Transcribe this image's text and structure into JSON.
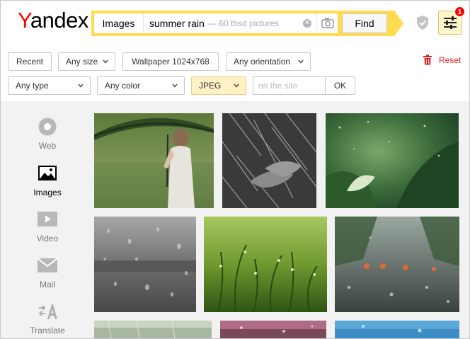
{
  "header": {
    "logo_first": "Y",
    "logo_rest": "andex",
    "search": {
      "service_tag": "Images",
      "query": "summer rain",
      "hint": "— 60 thsd pictures"
    },
    "find_label": "Find",
    "settings_badge": "1"
  },
  "filters": {
    "row1": [
      "Recent",
      "Any size",
      "Wallpaper 1024x768",
      "Any orientation"
    ],
    "row2": [
      "Any type",
      "Any color",
      "JPEG"
    ],
    "site_placeholder": "on the site",
    "ok_label": "OK",
    "reset_label": "Reset",
    "accent_color": "#ffdb4d",
    "reset_color": "#e02020"
  },
  "sidenav": {
    "items": [
      {
        "label": "Web",
        "icon": "web-icon",
        "active": false
      },
      {
        "label": "Images",
        "icon": "images-icon",
        "active": true
      },
      {
        "label": "Video",
        "icon": "video-icon",
        "active": false
      },
      {
        "label": "Mail",
        "icon": "mail-icon",
        "active": false
      },
      {
        "label": "Translate",
        "icon": "translate-icon",
        "active": false
      }
    ]
  },
  "results": {
    "tiles": [
      "woman-umbrella-rain",
      "hands-in-rain",
      "rain-on-leaves",
      "raindrops-on-glass",
      "wet-grass",
      "rainy-street-windshield",
      "rain-meadow",
      "pink-rain-drops",
      "blue-water-drops"
    ]
  }
}
